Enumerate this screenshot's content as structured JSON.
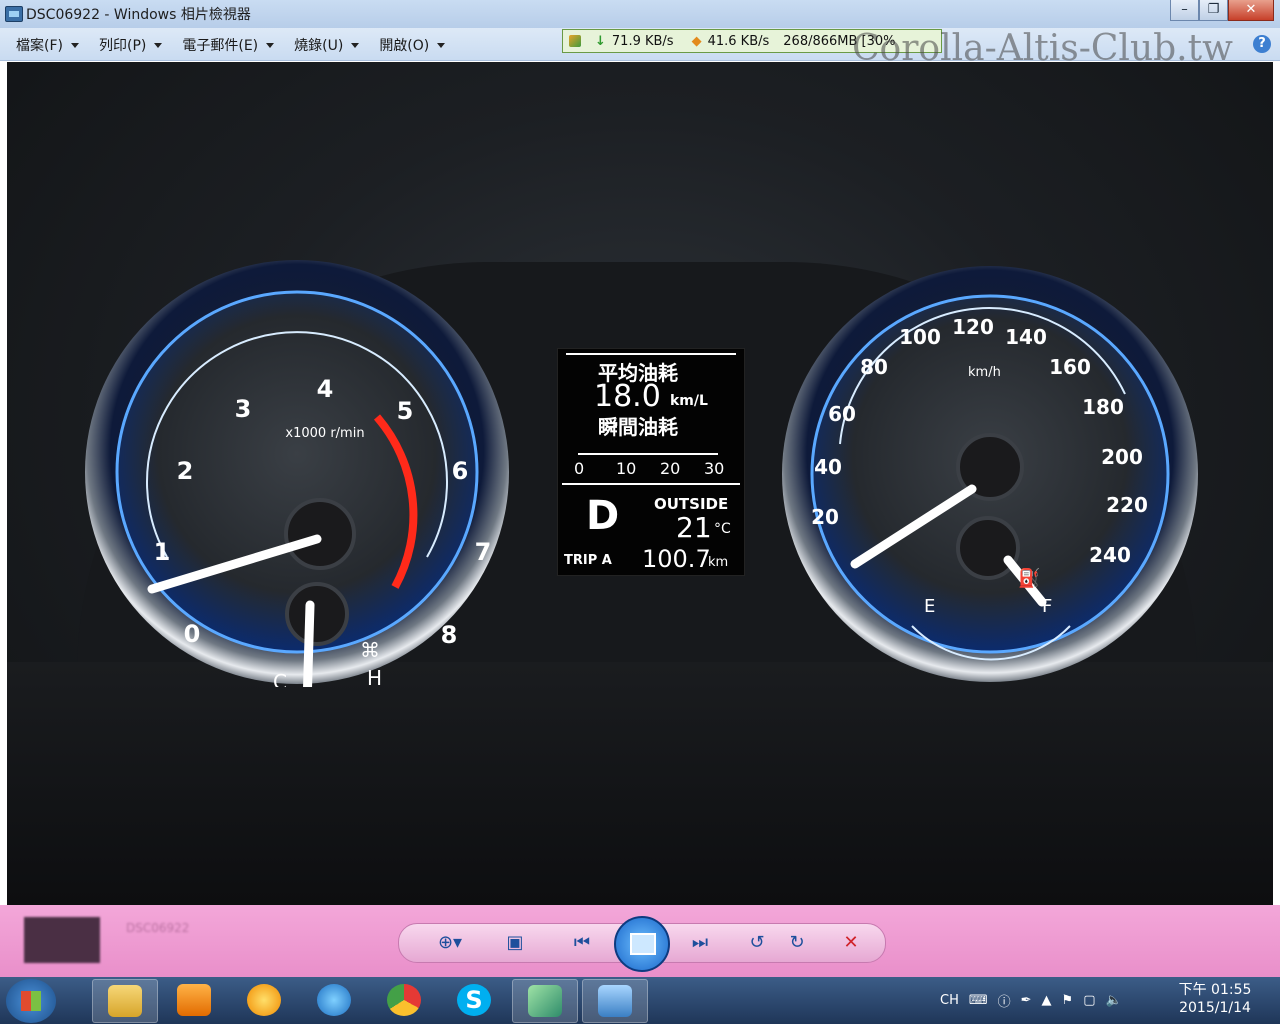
{
  "window": {
    "title": "DSC06922 - Windows 相片檢視器",
    "controls": [
      "minimize",
      "restore",
      "close"
    ]
  },
  "menu": [
    {
      "label": "檔案(F)"
    },
    {
      "label": "列印(P)"
    },
    {
      "label": "電子郵件(E)"
    },
    {
      "label": "燒錄(U)"
    },
    {
      "label": "開啟(O)"
    }
  ],
  "netmeter": {
    "down_speed": "71.9 KB/s",
    "up_speed": "41.6 KB/s",
    "usage": "268/866MB [30%"
  },
  "watermark": "Corolla-Altis-Club.tw",
  "dashboard": {
    "tachometer": {
      "unit_label": "x1000 r/min",
      "ticks": [
        "0",
        "1",
        "2",
        "3",
        "4",
        "5",
        "6",
        "7",
        "8"
      ],
      "temp_labels": [
        "C",
        "H"
      ]
    },
    "speedometer": {
      "unit_label": "km/h",
      "ticks": [
        "20",
        "40",
        "60",
        "80",
        "100",
        "120",
        "140",
        "160",
        "180",
        "200",
        "220",
        "240"
      ],
      "fuel_labels": [
        "E",
        "F"
      ]
    },
    "display": {
      "avg_fuel_label": "平均油耗",
      "avg_fuel_value": "18.0",
      "avg_fuel_unit": "km/L",
      "inst_fuel_label": "瞬間油耗",
      "scale": [
        "0",
        "10",
        "20",
        "30"
      ],
      "gear": "D",
      "outside_label": "OUTSIDE",
      "outside_temp": "21",
      "temp_unit": "°C",
      "trip_label": "TRIP A",
      "trip_value": "100.7",
      "trip_unit": "km"
    }
  },
  "viewer_toolbar": {
    "filename": "DSC06922",
    "buttons": [
      "zoom-button",
      "fit-window-button",
      "previous-button",
      "slideshow-button",
      "next-button",
      "rotate-ccw-button",
      "rotate-cw-button",
      "delete-button"
    ]
  },
  "taskbar": {
    "items": [
      "explorer",
      "media-player",
      "weather",
      "internet-explorer",
      "chrome",
      "skype",
      "editor",
      "photo-viewer"
    ],
    "tray_lang": "CH",
    "clock_time": "下午 01:55",
    "clock_date": "2015/1/14"
  }
}
